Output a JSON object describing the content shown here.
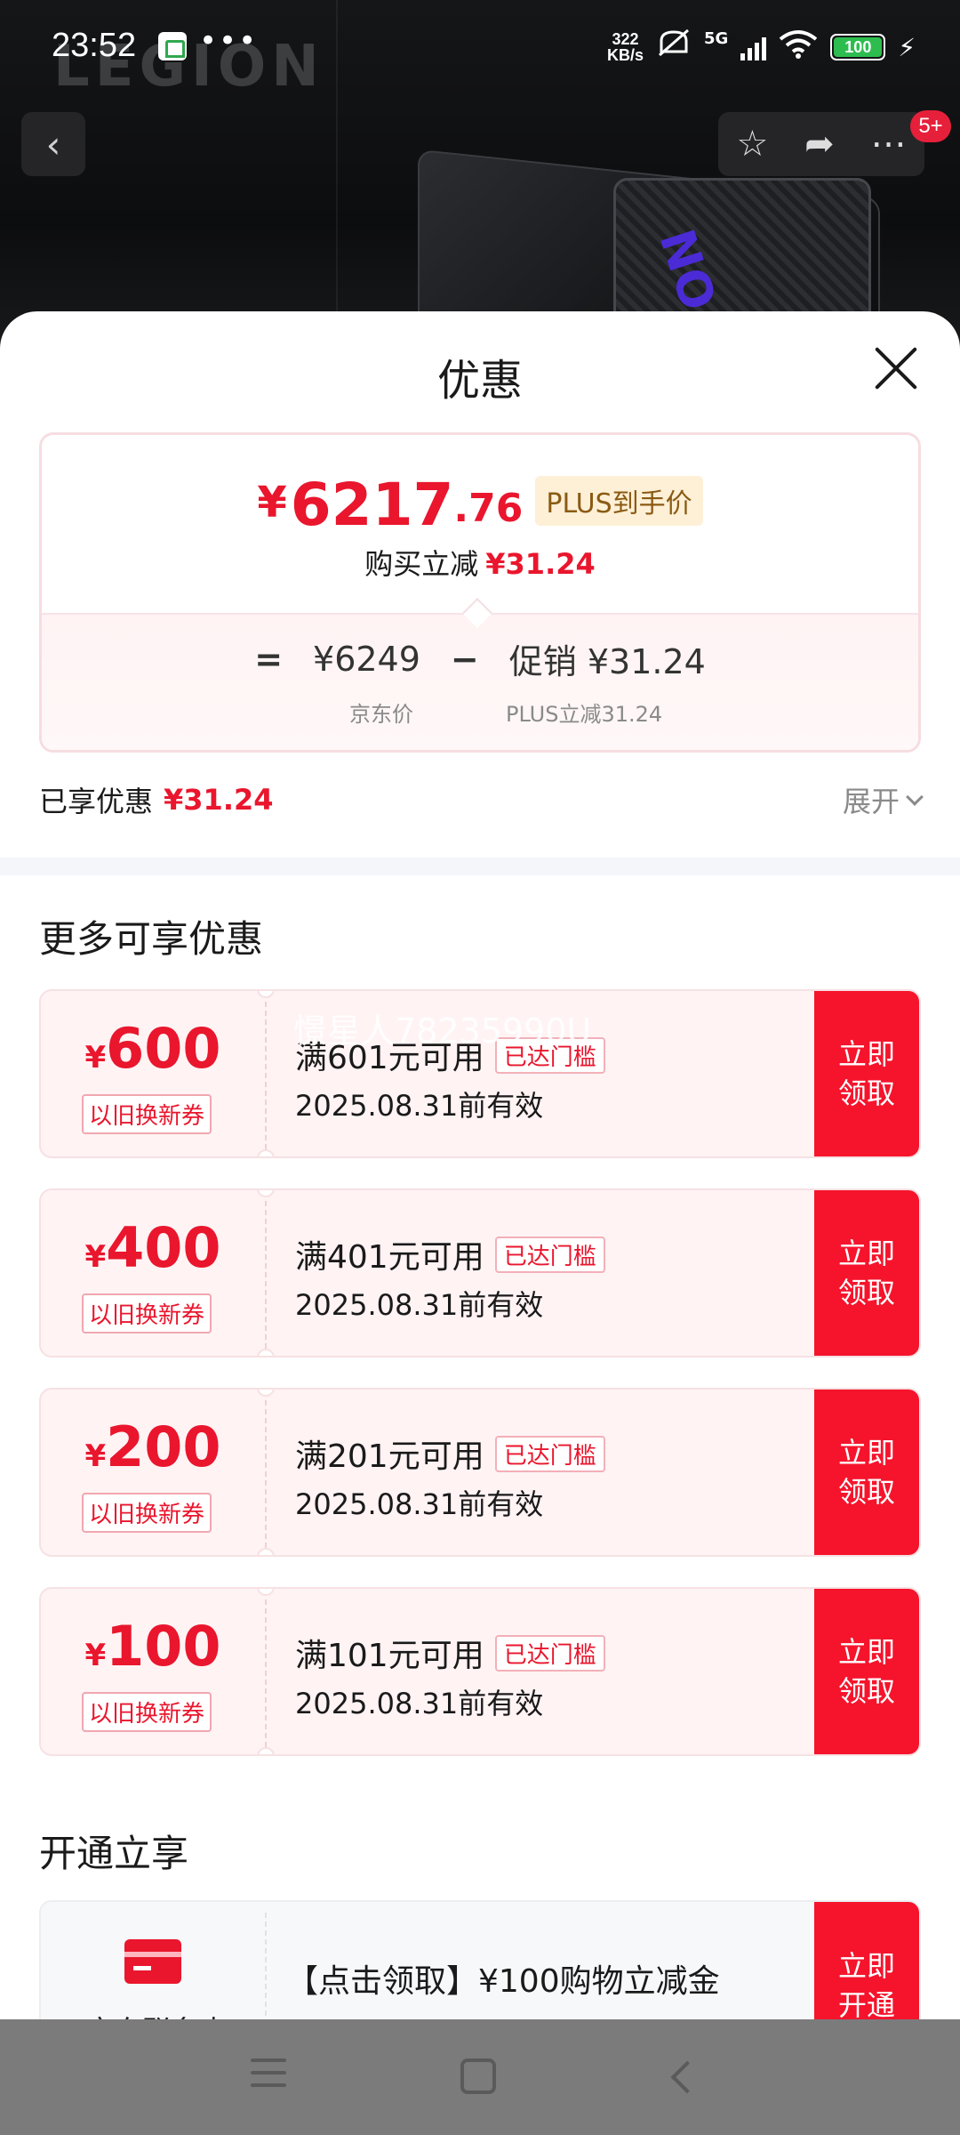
{
  "status_bar": {
    "time": "23:52",
    "speed_value": "322",
    "speed_unit": "KB/s",
    "network": "5G",
    "battery": "100"
  },
  "product_header": {
    "brand_logo": "LEGION",
    "product_logo": "NO",
    "cart_badge": "5+"
  },
  "sheet": {
    "title": "优惠",
    "price": {
      "currency": "¥",
      "integer": "6217",
      "decimal": ".76",
      "tag": "PLUS到手价",
      "discount_label": "购买立减",
      "discount_amount": "¥31.24"
    },
    "breakdown": {
      "equals": "=",
      "jd_price": "¥6249",
      "minus": "−",
      "promo": "促销 ¥31.24",
      "jd_price_label": "京东价",
      "promo_label": "PLUS立减31.24"
    },
    "enjoyed": {
      "label": "已享优惠",
      "amount": "¥31.24",
      "expand_label": "展开"
    },
    "more_title": "更多可享优惠",
    "watermark": "憬星人78235990U",
    "coupons": [
      {
        "currency": "¥",
        "value": "600",
        "type": "以旧换新券",
        "condition": "满601元可用",
        "threshold": "已达门槛",
        "validity": "2025.08.31前有效",
        "button": "立即领取"
      },
      {
        "currency": "¥",
        "value": "400",
        "type": "以旧换新券",
        "condition": "满401元可用",
        "threshold": "已达门槛",
        "validity": "2025.08.31前有效",
        "button": "立即领取"
      },
      {
        "currency": "¥",
        "value": "200",
        "type": "以旧换新券",
        "condition": "满201元可用",
        "threshold": "已达门槛",
        "validity": "2025.08.31前有效",
        "button": "立即领取"
      },
      {
        "currency": "¥",
        "value": "100",
        "type": "以旧换新券",
        "condition": "满101元可用",
        "threshold": "已达门槛",
        "validity": "2025.08.31前有效",
        "button": "立即领取"
      }
    ],
    "open_title": "开通立享",
    "plus_card": {
      "name": "京东联名卡",
      "text": "【点击领取】¥100购物立减金",
      "button": "立即开通"
    }
  },
  "colors": {
    "accent_red": "#e9162d",
    "button_red": "#f5142c",
    "plus_tag_bg": "#fdf0d6",
    "coupon_bg": "#fff3f4"
  }
}
